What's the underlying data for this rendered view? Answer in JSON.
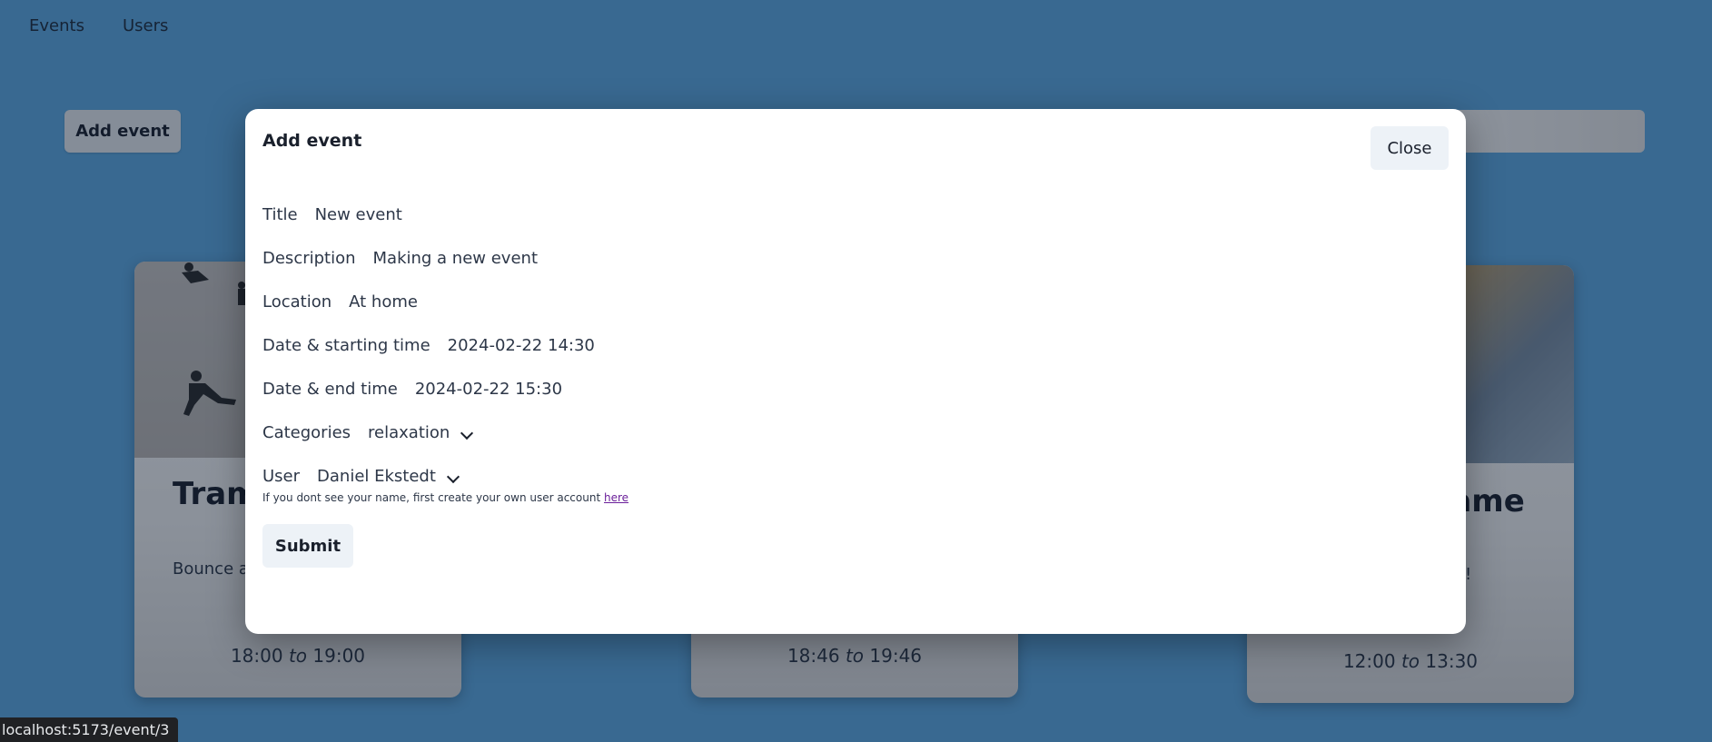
{
  "nav": {
    "events": "Events",
    "users": "Users"
  },
  "toolbar": {
    "add_event": "Add event"
  },
  "cards": [
    {
      "title": "Tram",
      "description": "Bounce a",
      "time_start": "18:00",
      "time_sep": "to",
      "time_end": "19:00"
    },
    {
      "time_start": "18:46",
      "time_sep": "to",
      "time_end": "19:46"
    },
    {
      "title": "game",
      "description": "!",
      "time_start": "12:00",
      "time_sep": "to",
      "time_end": "13:30"
    }
  ],
  "modal": {
    "title": "Add event",
    "close_label": "Close",
    "fields": {
      "title": {
        "label": "Title",
        "value": "New event"
      },
      "description": {
        "label": "Description",
        "value": "Making a new event"
      },
      "location": {
        "label": "Location",
        "value": "At home"
      },
      "start": {
        "label": "Date & starting time",
        "value": "2024-02-22 14:30"
      },
      "end": {
        "label": "Date & end time",
        "value": "2024-02-22 15:30"
      },
      "categories": {
        "label": "Categories",
        "value": "relaxation"
      },
      "user": {
        "label": "User",
        "value": "Daniel Ekstedt"
      }
    },
    "hint_text": "If you dont see your name, first create your own user account",
    "hint_link": "here",
    "submit_label": "Submit"
  },
  "status_bar": {
    "url": "localhost:5173/event/3"
  },
  "colors": {
    "background": "#5fabe3",
    "link": "#6b1f9a",
    "button": "#edf2f7"
  }
}
